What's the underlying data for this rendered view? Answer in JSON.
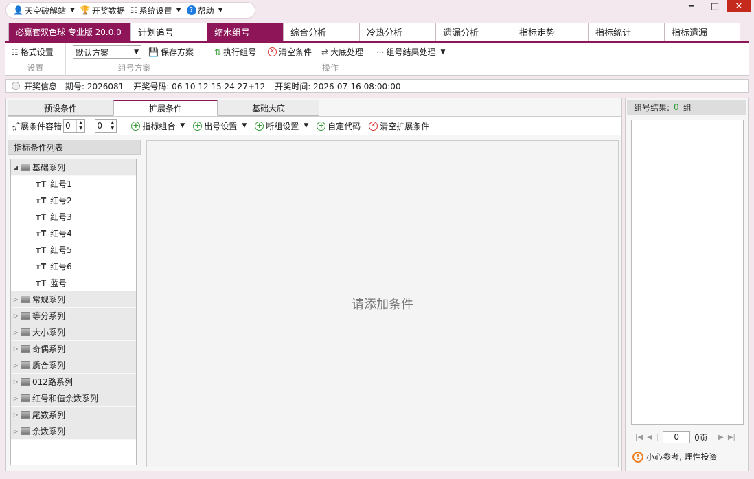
{
  "menu": {
    "items": [
      "天空破解站",
      "开奖数据",
      "系统设置",
      "帮助"
    ]
  },
  "window": {
    "min": "−",
    "max": "□",
    "close": "✕"
  },
  "tabs": [
    "必赢套双色球 专业版 20.0.0",
    "计划追号",
    "缩水组号",
    "综合分析",
    "冷热分析",
    "遗漏分析",
    "指标走势",
    "指标统计",
    "指标遗漏"
  ],
  "toolbar": {
    "format_settings": "格式设置",
    "group_settings": "设置",
    "scheme_select": "默认方案",
    "save_scheme": "保存方案",
    "group_scheme": "组号方案",
    "execute": "执行组号",
    "clear": "清空条件",
    "dadi": "大底处理",
    "result_process": "组号结果处理",
    "group_ops": "操作"
  },
  "info": {
    "label": "开奖信息",
    "issue": "期号: 2026081",
    "numbers": "开奖号码: 06 10 12 15 24 27+12",
    "time": "开奖时间: 2026-07-16 08:00:00"
  },
  "subtabs": [
    "预设条件",
    "扩展条件",
    "基础大底"
  ],
  "options": {
    "tolerance": "扩展条件容错",
    "from": "0",
    "dash": "-",
    "to": "0",
    "combo": "指标组合",
    "output": "出号设置",
    "break": "断组设置",
    "custom": "自定代码",
    "clear_ext": "清空扩展条件"
  },
  "list": {
    "head": "指标条件列表",
    "group0": "基础系列",
    "children": [
      "红号1",
      "红号2",
      "红号3",
      "红号4",
      "红号5",
      "红号6",
      "蓝号"
    ],
    "groups": [
      "常规系列",
      "等分系列",
      "大小系列",
      "奇偶系列",
      "质合系列",
      "012路系列",
      "红号和值余数系列",
      "尾数系列",
      "余数系列"
    ]
  },
  "main": {
    "placeholder": "请添加条件"
  },
  "result": {
    "label": "组号结果:",
    "count": "0",
    "unit": "组",
    "page": "0",
    "pages": "0页",
    "warn": "小心参考, 理性投资"
  }
}
